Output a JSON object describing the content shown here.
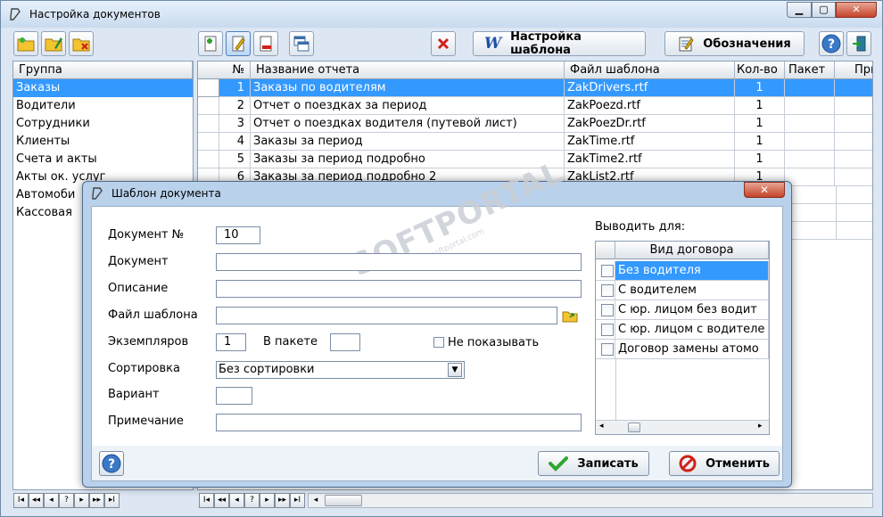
{
  "window": {
    "title": "Настройка документов"
  },
  "toolbar": {
    "template_settings": "Настройка шаблона",
    "designations": "Обозначения"
  },
  "groups": {
    "header": "Группа",
    "items": [
      "Заказы",
      "Водители",
      "Сотрудники",
      "Клиенты",
      "Счета и акты",
      "Акты ок. услуг",
      "Автомоби",
      "Кассовая"
    ]
  },
  "reports": {
    "columns": [
      "№",
      "Название отчета",
      "Файл шаблона",
      "Кол-во",
      "Пакет",
      "Прим"
    ],
    "rows": [
      {
        "n": "1",
        "name": "Заказы по водителям",
        "file": "ZakDrivers.rtf",
        "qty": "1"
      },
      {
        "n": "2",
        "name": "Отчет о поездках за период",
        "file": "ZakPoezd.rtf",
        "qty": "1"
      },
      {
        "n": "3",
        "name": "Отчет о поездках водителя (путевой лист)",
        "file": "ZakPoezDr.rtf",
        "qty": "1"
      },
      {
        "n": "4",
        "name": "Заказы за период",
        "file": "ZakTime.rtf",
        "qty": "1"
      },
      {
        "n": "5",
        "name": "Заказы за период подробно",
        "file": "ZakTime2.rtf",
        "qty": "1"
      },
      {
        "n": "6",
        "name": "Заказы за период подробно 2",
        "file": "ZakList2.rtf",
        "qty": "1"
      }
    ]
  },
  "navigator": [
    "I◂",
    "◂◂",
    "◂",
    "?",
    "▸",
    "▸▸",
    "▸I"
  ],
  "dialog": {
    "title": "Шаблон документа",
    "doc_no_label": "Документ №",
    "doc_no_value": "10",
    "doc_label": "Документ",
    "desc_label": "Описание",
    "file_label": "Файл шаблона",
    "copies_label": "Экземпляров",
    "copies_value": "1",
    "packet_label": "В пакете",
    "hide_label": "Не показывать",
    "sort_label": "Сортировка",
    "sort_value": "Без сортировки",
    "variant_label": "Вариант",
    "note_label": "Примечание",
    "output_for_label": "Выводить для:",
    "contract_header": "Вид договора",
    "contracts": [
      "Без водителя",
      "С водителем",
      "С юр. лицом без водит",
      "С юр. лицом с водителе",
      "Договор замены атомо"
    ],
    "save_label": "Записать",
    "cancel_label": "Отменить"
  },
  "watermark": {
    "text": "SOFTPORTAL",
    "url": "www.softportal.com"
  },
  "colors": {
    "selection": "#3399ff",
    "dialog_frame": "#b9d1ea",
    "close": "#c5432a"
  }
}
